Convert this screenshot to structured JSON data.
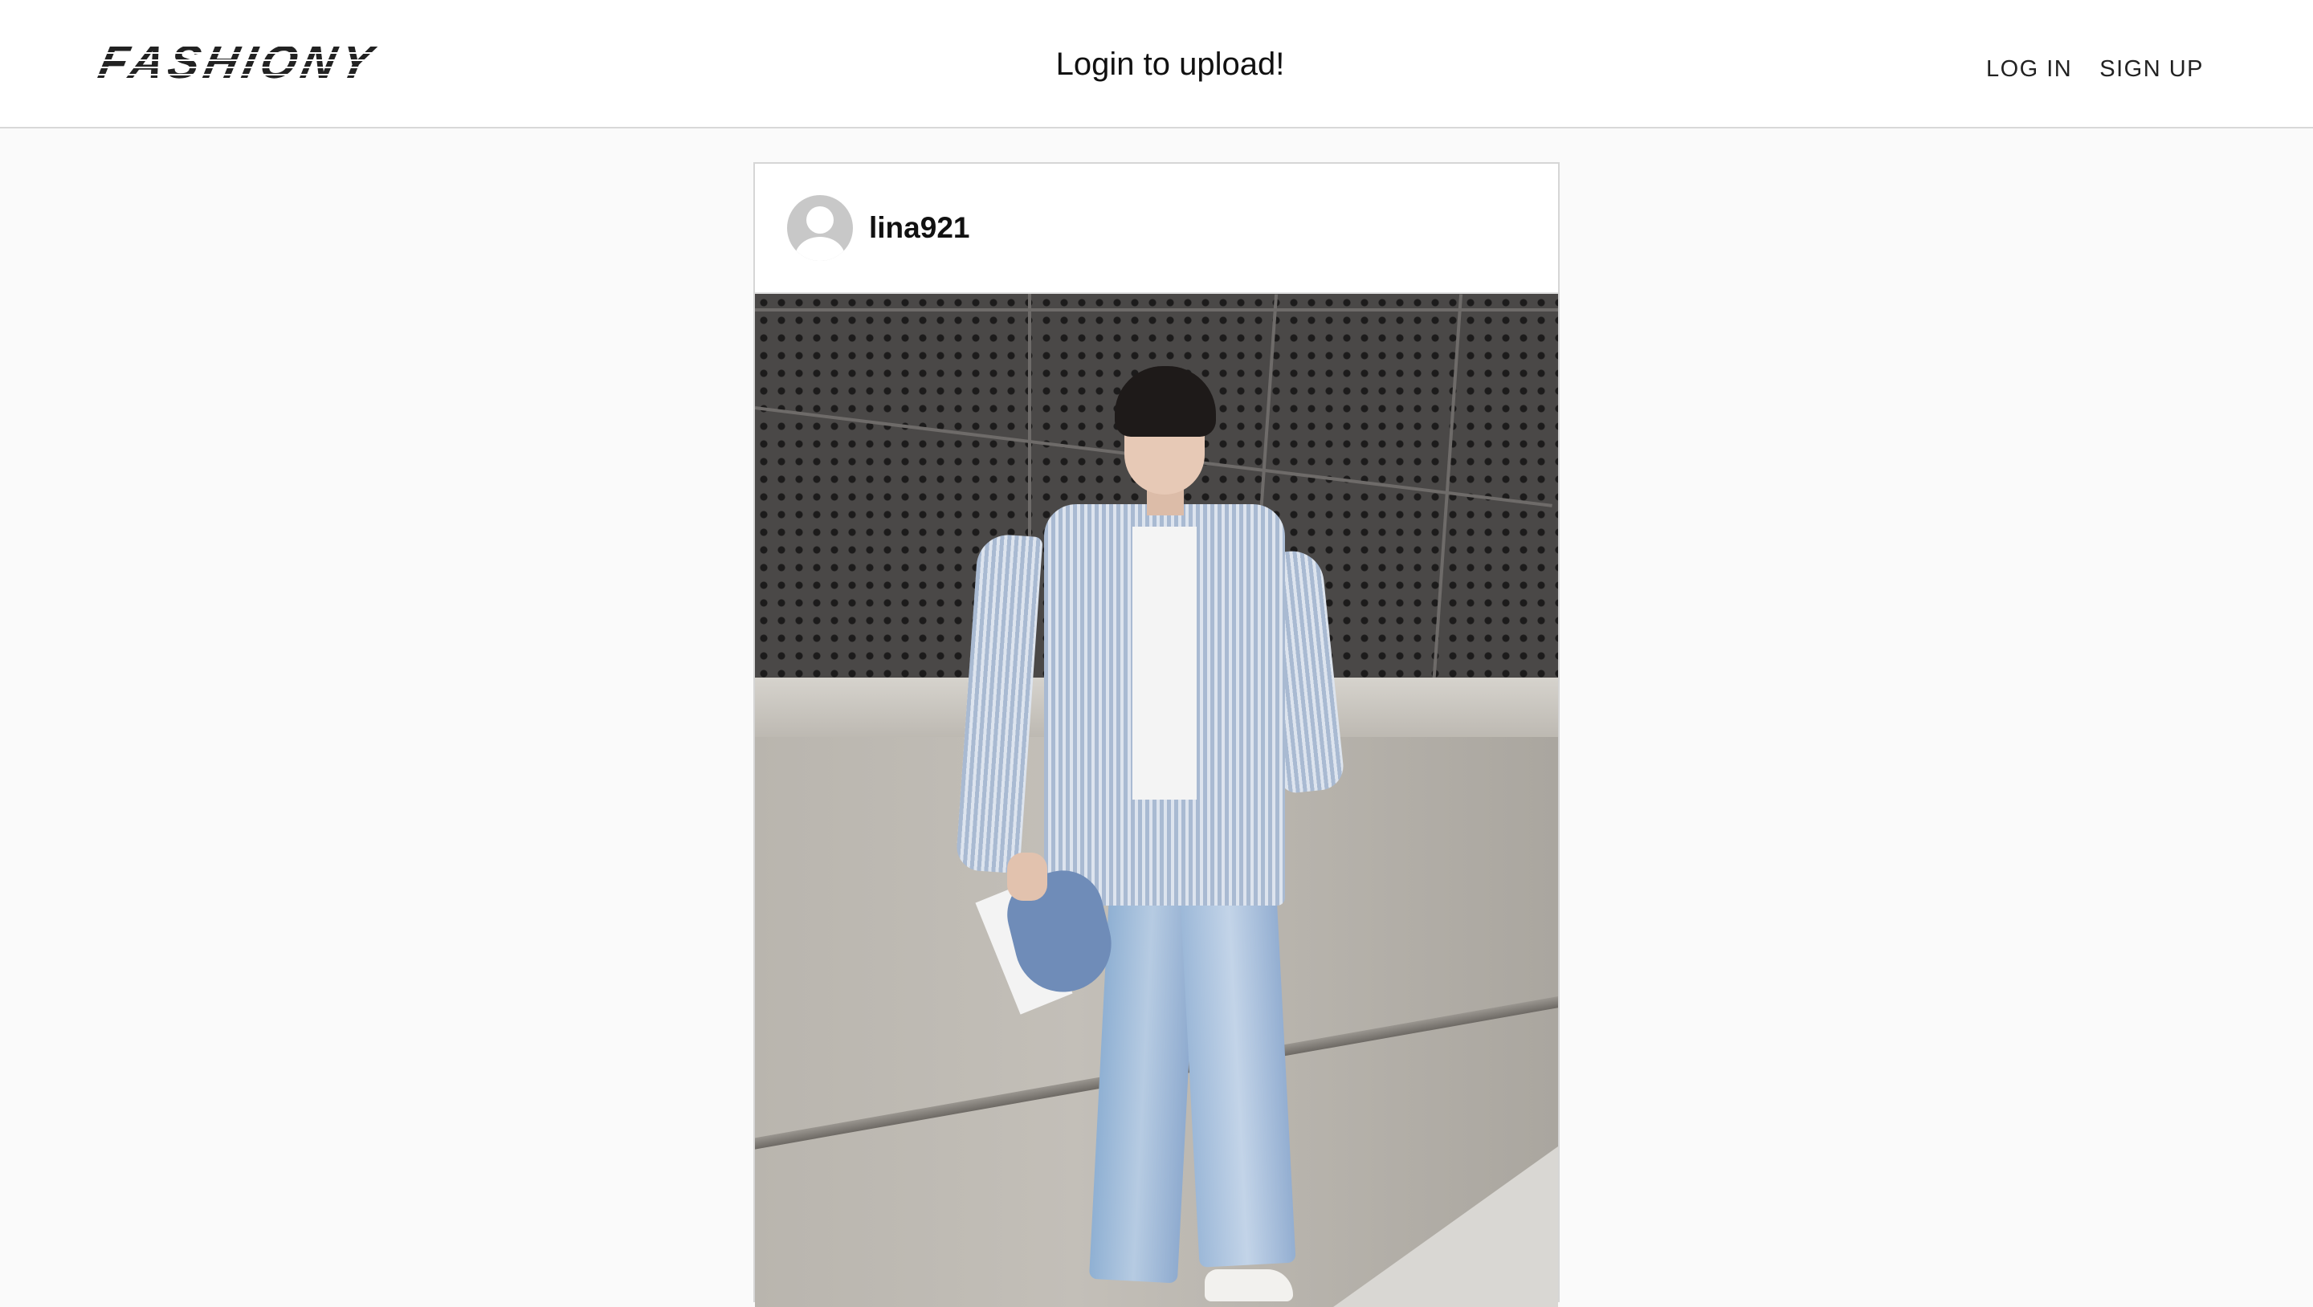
{
  "header": {
    "logo_text": "FASHIONY",
    "center_message": "Login to upload!",
    "nav": {
      "login_label": "LOG IN",
      "signup_label": "SIGN UP"
    }
  },
  "post": {
    "username": "lina921",
    "avatar_icon": "default-user-icon",
    "photo_alt": "street fashion photo"
  },
  "colors": {
    "page_background": "#fafafa",
    "header_background": "#ffffff",
    "border": "#d8d8d8"
  }
}
